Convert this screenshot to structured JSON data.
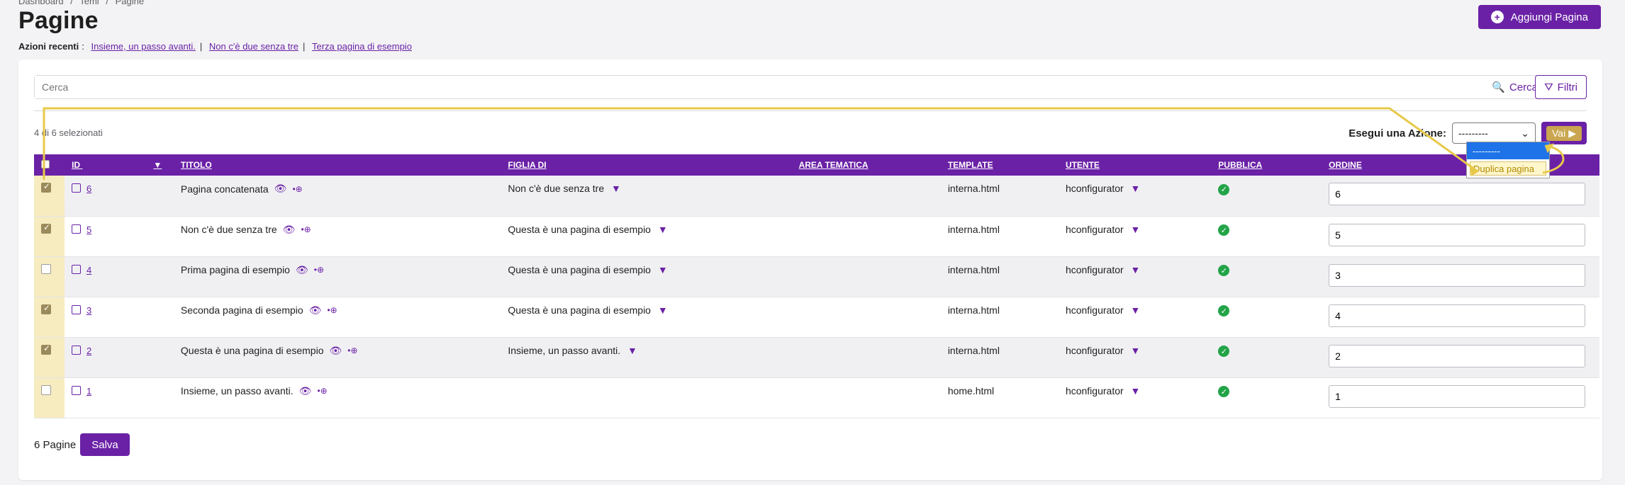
{
  "breadcrumb": [
    "Dashboard",
    "/",
    "Temi",
    "/",
    "Pagine"
  ],
  "page": {
    "title": "Pagine",
    "add_button": "Aggiungi Pagina"
  },
  "recent": {
    "label": "Azioni recenti",
    "items": [
      "Insieme, un passo avanti.",
      "Non c'è due senza tre",
      "Terza pagina di esempio"
    ]
  },
  "search": {
    "placeholder": "Cerca",
    "button": "Cerca",
    "filters": "Filtri"
  },
  "selection": {
    "count_text": "4 di 6 selezionati",
    "action_label": "Esegui una Azione:",
    "selected_value": "---------",
    "go_label": "Vai",
    "dropdown_options": [
      "---------",
      "Duplica pagina"
    ]
  },
  "table": {
    "headers": [
      "ID",
      "TITOLO",
      "FIGLIA DI",
      "AREA TEMATICA",
      "TEMPLATE",
      "UTENTE",
      "PUBBLICA",
      "ORDINE"
    ],
    "rows": [
      {
        "checked": true,
        "id": "6",
        "title": "Pagina concatenata",
        "parent": "Non c'è due senza tre",
        "area": "",
        "template": "interna.html",
        "user": "hconfigurator",
        "public": true,
        "order": "6"
      },
      {
        "checked": true,
        "id": "5",
        "title": "Non c'è due senza tre",
        "parent": "Questa è una pagina di esempio",
        "area": "",
        "template": "interna.html",
        "user": "hconfigurator",
        "public": true,
        "order": "5"
      },
      {
        "checked": false,
        "id": "4",
        "title": "Prima pagina di esempio",
        "parent": "Questa è una pagina di esempio",
        "area": "",
        "template": "interna.html",
        "user": "hconfigurator",
        "public": true,
        "order": "3"
      },
      {
        "checked": true,
        "id": "3",
        "title": "Seconda pagina di esempio",
        "parent": "Questa è una pagina di esempio",
        "area": "",
        "template": "interna.html",
        "user": "hconfigurator",
        "public": true,
        "order": "4"
      },
      {
        "checked": true,
        "id": "2",
        "title": "Questa è una pagina di esempio",
        "parent": "Insieme, un passo avanti.",
        "area": "",
        "template": "interna.html",
        "user": "hconfigurator",
        "public": true,
        "order": "2"
      },
      {
        "checked": false,
        "id": "1",
        "title": "Insieme, un passo avanti.",
        "parent": "",
        "area": "",
        "template": "home.html",
        "user": "hconfigurator",
        "public": true,
        "order": "1"
      }
    ]
  },
  "footer": {
    "count_text": "6 Pagine",
    "save_label": "Salva"
  },
  "colors": {
    "accent": "#6a21a6",
    "highlight": "#e7c94a",
    "success": "#22a447"
  }
}
